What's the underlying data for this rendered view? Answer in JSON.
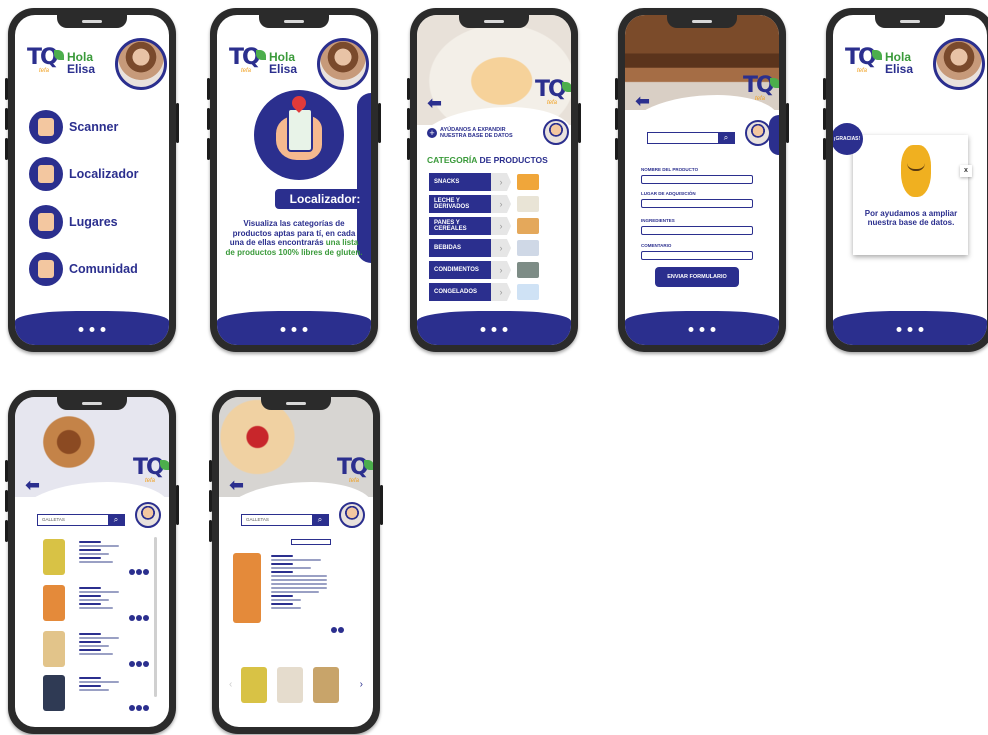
{
  "greeting": {
    "hola": "Hola",
    "name": "Elisa"
  },
  "menu": [
    {
      "label": "Scanner",
      "icon": "scanner-icon"
    },
    {
      "label": "Localizador",
      "icon": "map-pin-icon"
    },
    {
      "label": "Lugares",
      "icon": "store-icon"
    },
    {
      "label": "Comunidad",
      "icon": "community-icon"
    }
  ],
  "locator": {
    "title": "Localizador:",
    "text_1": "Visualiza las categorías de productos aptas para tí, en cada una de ellas encontrarás",
    "text_2": "una lista de productos 100% libres de gluten."
  },
  "categories_screen": {
    "help": "AYÚDANOS A EXPANDIR NUESTRA BASE DE DATOS",
    "title_a": "CATEGORÍA",
    "title_b": "DE PRODUCTOS",
    "items": [
      "SNACKS",
      "LECHE Y DERIVADOS",
      "PANES Y CEREALES",
      "BEBIDAS",
      "CONDIMENTOS",
      "CONGELADOS"
    ],
    "item_colors": [
      "#f0a63a",
      "#e9e4d6",
      "#e4a85b",
      "#cfd8e6",
      "#7d8c86",
      "#cfe2f5"
    ]
  },
  "form": {
    "fields": [
      "NOMBRE DEL PRODUCTO",
      "LUGAR DE ADQUISICIÓN",
      "INGREDIENTES",
      "COMENTARIO"
    ],
    "submit": "ENVIAR FORMULARIO"
  },
  "thanks": {
    "bubble": "¡GRACIAS!",
    "close": "x",
    "text": "Por ayudamos a ampliar nuestra base de datos."
  },
  "search": {
    "value": "GALLETAS"
  },
  "colors": {
    "primary": "#2b2f8e",
    "green": "#3a9a3a"
  }
}
